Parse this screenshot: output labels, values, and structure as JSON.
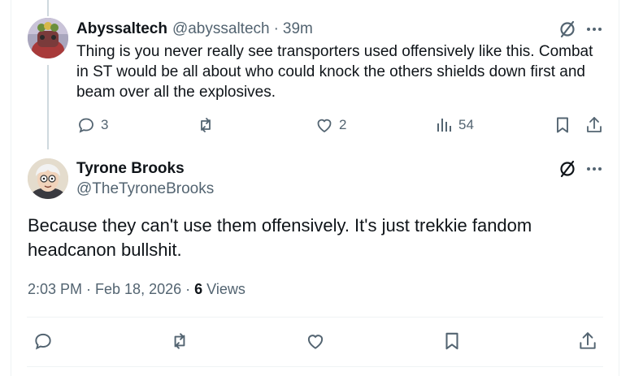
{
  "reply": {
    "display_name": "Abyssaltech",
    "handle": "@abyssaltech",
    "separator": "·",
    "time_ago": "39m",
    "text": "Thing is you never really see transporters used offensively like this. Combat in ST would be all about who could knock the others shields down first and beam over all the explosives.",
    "stats": {
      "replies": "3",
      "likes": "2",
      "views": "54"
    }
  },
  "main": {
    "display_name": "Tyrone Brooks",
    "handle": "@TheTyroneBrooks",
    "text": "Because they can't use them offensively. It's just trekkie fandom headcanon bullshit.",
    "timestamp": "2:03 PM · Feb 18, 2026 · ",
    "views_count": "6",
    "views_label": " Views"
  },
  "colors": {
    "text": "#0f1419",
    "muted": "#536471",
    "border": "#eff3f4"
  }
}
